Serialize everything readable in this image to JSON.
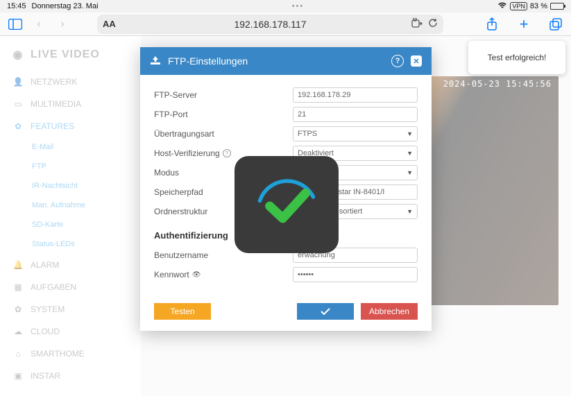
{
  "status": {
    "time": "15:45",
    "date": "Donnerstag 23. Mai",
    "vpn": "VPN",
    "battery_pct": "83 %"
  },
  "toolbar": {
    "aa": "AA",
    "url": "192.168.178.117"
  },
  "toast": {
    "message": "Test erfolgreich!"
  },
  "sidebar": {
    "header": "LIVE VIDEO",
    "items": {
      "netzwerk": "NETZWERK",
      "multimedia": "MULTIMEDIA",
      "features": "FEATURES",
      "alarm": "ALARM",
      "aufgaben": "AUFGABEN",
      "system": "SYSTEM",
      "cloud": "CLOUD",
      "smarthome": "SMARTHOME",
      "instar": "INSTAR"
    },
    "subs": {
      "email": "E-Mail",
      "ftp": "FTP",
      "ir": "IR-Nachtsicht",
      "man": "Man. Aufnahme",
      "sd": "SD-Karte",
      "leds": "Status-LEDs"
    }
  },
  "video": {
    "timestamp": "2024-05-23 15:45:56"
  },
  "modal": {
    "title": "FTP-Einstellungen",
    "labels": {
      "server": "FTP-Server",
      "port": "FTP-Port",
      "transfer": "Übertragungsart",
      "hostverify": "Host-Verifizierung",
      "mode": "Modus",
      "path": "Speicherpfad",
      "folder": "Ordnerstruktur",
      "auth": "Authentifizierung",
      "user": "Benutzername",
      "pass": "Kennwort"
    },
    "values": {
      "server": "192.168.178.29",
      "port": "21",
      "transfer": "FTPS",
      "hostverify": "Deaktiviert",
      "mode": "PASV",
      "path": "rveillance/Instar IN-8401/I",
      "folder": "nach Tagen sortiert",
      "user": "erwachung",
      "pass": "••••••"
    },
    "buttons": {
      "test": "Testen",
      "cancel": "Abbrechen"
    }
  }
}
